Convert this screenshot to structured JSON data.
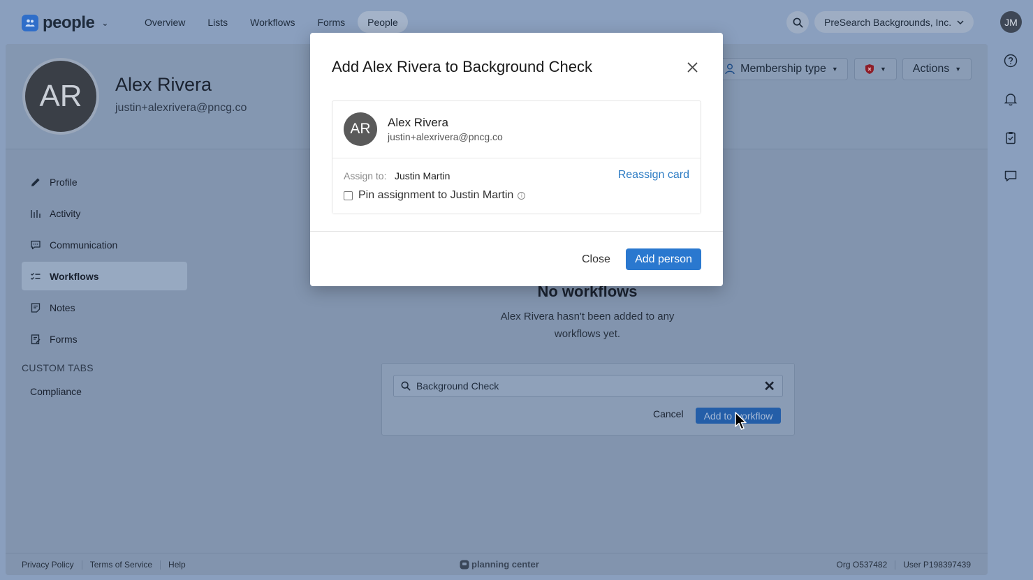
{
  "app": {
    "name": "people",
    "nav": [
      "Overview",
      "Lists",
      "Workflows",
      "Forms",
      "People"
    ],
    "active_nav": "People",
    "org_name": "PreSearch Backgrounds, Inc.",
    "user_initials": "JM"
  },
  "person": {
    "initials": "AR",
    "name": "Alex Rivera",
    "email": "justin+alexrivera@pncg.co"
  },
  "header_actions": {
    "membership_label": "Membership type",
    "actions_label": "Actions"
  },
  "sidebar": {
    "items": [
      {
        "label": "Profile",
        "icon": "pencil-icon"
      },
      {
        "label": "Activity",
        "icon": "bars-icon"
      },
      {
        "label": "Communication",
        "icon": "chat-icon"
      },
      {
        "label": "Workflows",
        "icon": "list-check-icon"
      },
      {
        "label": "Notes",
        "icon": "note-icon"
      },
      {
        "label": "Forms",
        "icon": "form-icon"
      }
    ],
    "active": "Workflows",
    "custom_tabs_heading": "CUSTOM TABS",
    "custom_tabs": [
      "Compliance"
    ]
  },
  "empty_state": {
    "title": "No workflows",
    "text": "Alex Rivera hasn't been added to any workflows yet."
  },
  "workflow_picker": {
    "search_value": "Background Check",
    "cancel_label": "Cancel",
    "add_label": "Add to workflow"
  },
  "footer": {
    "links": [
      "Privacy Policy",
      "Terms of Service",
      "Help"
    ],
    "brand": "planning center",
    "org": "Org O537482",
    "user": "User P198397439"
  },
  "modal": {
    "title": "Add Alex Rivera to Background Check",
    "card": {
      "initials": "AR",
      "name": "Alex Rivera",
      "email": "justin+alexrivera@pncg.co"
    },
    "assign_label": "Assign to:",
    "assign_value": "Justin Martin",
    "reassign_label": "Reassign card",
    "pin_label": "Pin assignment to Justin Martin",
    "pin_checked": false,
    "close_label": "Close",
    "add_label": "Add person"
  },
  "colors": {
    "primary": "#2a78cf",
    "link": "#2d7cc4",
    "overlay": "#8a9fbe"
  }
}
